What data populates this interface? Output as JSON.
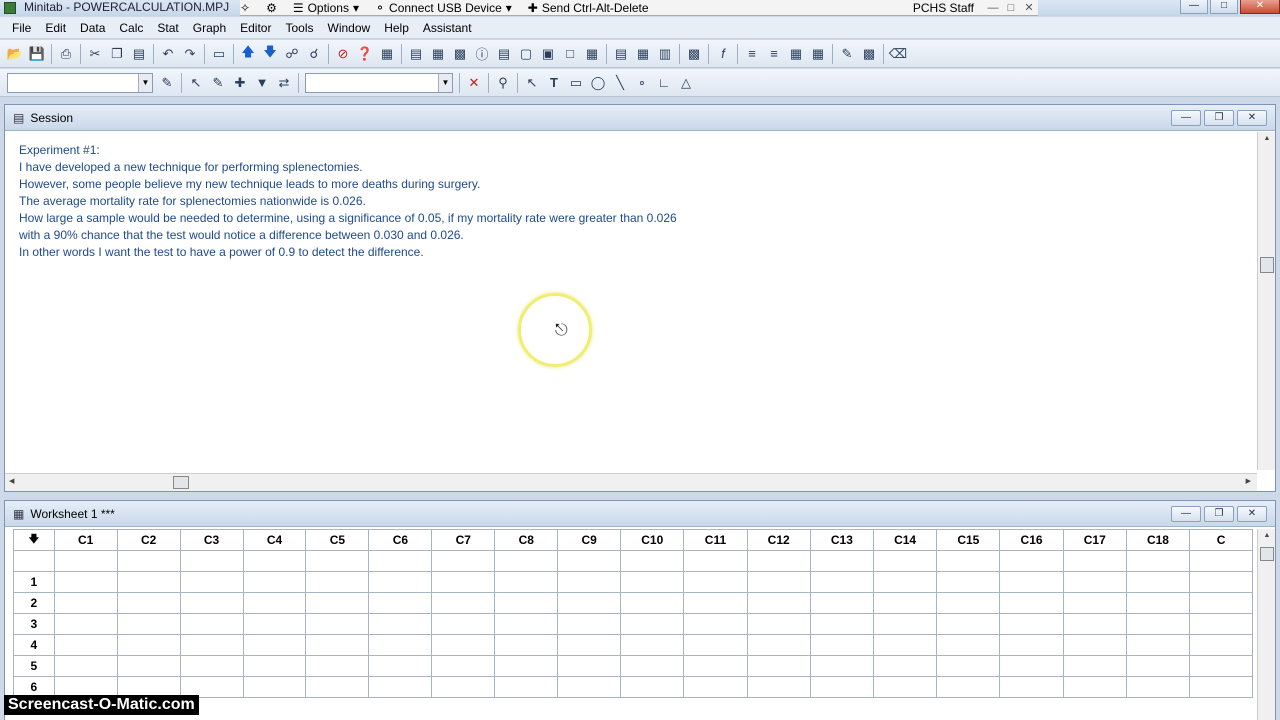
{
  "window": {
    "title": "Minitab - POWERCALCULATION.MPJ"
  },
  "remote_bar": {
    "options_label": "Options",
    "usb_label": "Connect USB Device",
    "cad_label": "Send Ctrl-Alt-Delete",
    "user_label": "PCHS Staff"
  },
  "menu": [
    "File",
    "Edit",
    "Data",
    "Calc",
    "Stat",
    "Graph",
    "Editor",
    "Tools",
    "Window",
    "Help",
    "Assistant"
  ],
  "session": {
    "title": "Session",
    "lines": [
      "Experiment #1:",
      "I have developed a new technique for performing splenectomies.",
      "However, some people believe my new technique leads to more deaths during surgery.",
      "The average mortality rate for splenectomies nationwide is 0.026.",
      "How large a sample would be needed to determine, using a significance of 0.05, if my mortality rate were greater than 0.026",
      "with a 90% chance that the test would notice a difference between 0.030 and 0.026.",
      "In other words I want the test to have a power of 0.9 to detect the difference."
    ]
  },
  "worksheet": {
    "title": "Worksheet 1 ***",
    "columns": [
      "C1",
      "C2",
      "C3",
      "C4",
      "C5",
      "C6",
      "C7",
      "C8",
      "C9",
      "C10",
      "C11",
      "C12",
      "C13",
      "C14",
      "C15",
      "C16",
      "C17",
      "C18",
      "C"
    ],
    "rows": [
      "1",
      "2",
      "3",
      "4",
      "5",
      "6"
    ]
  },
  "watermark": "Screencast-O-Matic.com"
}
